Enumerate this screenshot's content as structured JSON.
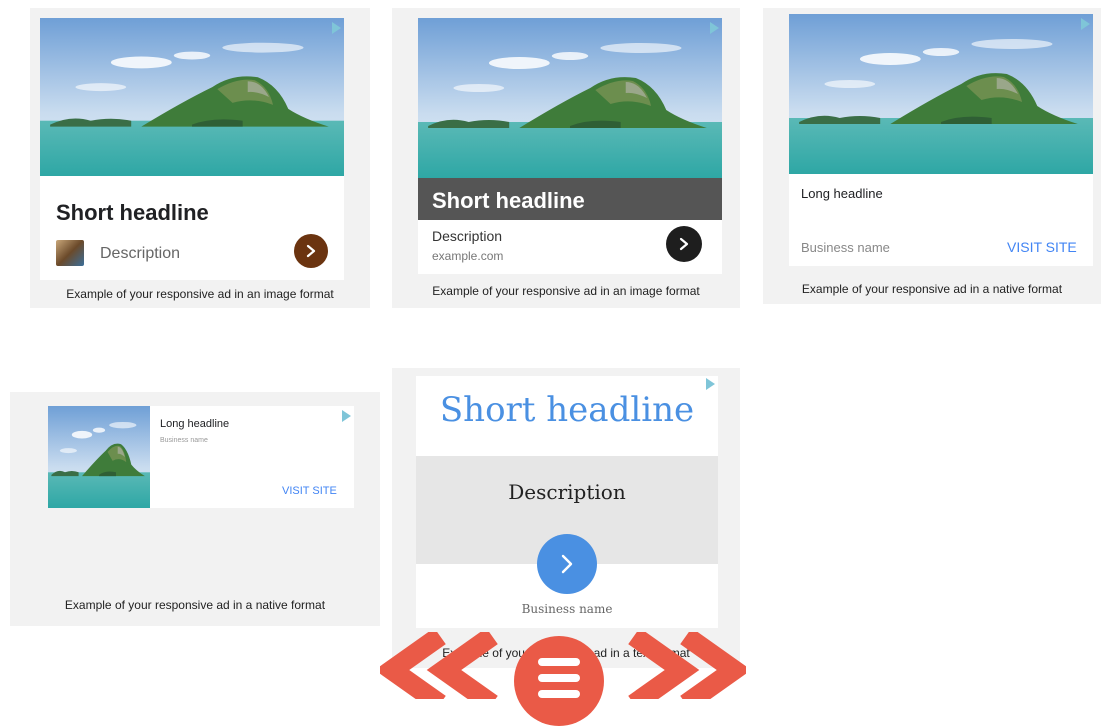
{
  "ads": [
    {
      "headline": "Short headline",
      "description": "Description",
      "caption": "Example of your responsive ad in an image format"
    },
    {
      "headline": "Short headline",
      "description": "Description",
      "url": "example.com",
      "caption": "Example of your responsive ad in an image format"
    },
    {
      "headline": "Long headline",
      "business": "Business name",
      "cta": "VISIT SITE",
      "caption": "Example of your responsive ad in a native format"
    },
    {
      "headline": "Long headline",
      "business": "Business name",
      "cta": "VISIT SITE",
      "caption": "Example of your responsive ad in a native format"
    },
    {
      "headline": "Short headline",
      "description": "Description",
      "business": "Business name",
      "caption": "Example of your responsive ad in a text format"
    }
  ],
  "colors": {
    "brown_button": "#6b3410",
    "dark_button": "#1e1e1e",
    "blue_button": "#4a90e2",
    "link_blue": "#4285f4",
    "overlay_toolbar": "#ea5a47"
  },
  "icons": {
    "adchoices": "adchoices-icon",
    "chevron": "chevron-right-icon",
    "thumbnail": "thumbnail-icon",
    "prev": "double-chevron-left-icon",
    "menu": "hamburger-menu-icon",
    "next": "double-chevron-right-icon"
  }
}
